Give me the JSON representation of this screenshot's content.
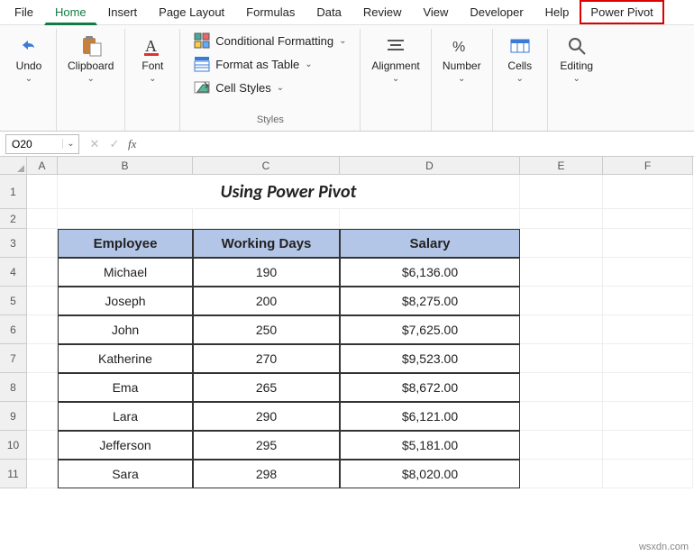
{
  "menu": {
    "items": [
      "File",
      "Home",
      "Insert",
      "Page Layout",
      "Formulas",
      "Data",
      "Review",
      "View",
      "Developer",
      "Help",
      "Power Pivot"
    ],
    "active": "Home",
    "highlighted": "Power Pivot"
  },
  "ribbon": {
    "undo": "Undo",
    "clipboard": "Clipboard",
    "font": "Font",
    "styles_label": "Styles",
    "cond_fmt": "Conditional Formatting",
    "fmt_table": "Format as Table",
    "cell_styles": "Cell Styles",
    "alignment": "Alignment",
    "number": "Number",
    "cells": "Cells",
    "editing": "Editing"
  },
  "namebox": {
    "value": "O20"
  },
  "columns": [
    "A",
    "B",
    "C",
    "D",
    "E",
    "F"
  ],
  "title": "Using Power Pivot",
  "table": {
    "headers": [
      "Employee",
      "Working Days",
      "Salary"
    ],
    "rows": [
      {
        "emp": "Michael",
        "days": "190",
        "sal": "$6,136.00"
      },
      {
        "emp": "Joseph",
        "days": "200",
        "sal": "$8,275.00"
      },
      {
        "emp": "John",
        "days": "250",
        "sal": "$7,625.00"
      },
      {
        "emp": "Katherine",
        "days": "270",
        "sal": "$9,523.00"
      },
      {
        "emp": "Ema",
        "days": "265",
        "sal": "$8,672.00"
      },
      {
        "emp": "Lara",
        "days": "290",
        "sal": "$6,121.00"
      },
      {
        "emp": "Jefferson",
        "days": "295",
        "sal": "$5,181.00"
      },
      {
        "emp": "Sara",
        "days": "298",
        "sal": "$8,020.00"
      }
    ]
  },
  "watermark": "wsxdn.com",
  "row_heights": {
    "title": 38,
    "blank": 22,
    "header": 32,
    "data": 32
  }
}
